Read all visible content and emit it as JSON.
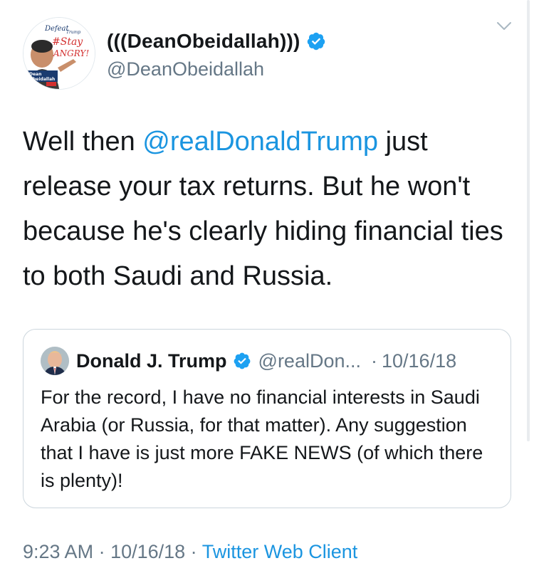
{
  "author": {
    "display_name": "(((DeanObeidallah)))",
    "handle": "@DeanObeidallah",
    "avatar_text_top": "Defeat",
    "avatar_text_trump": "Trump",
    "avatar_text_stay": "#Stay",
    "avatar_text_angry": "ANGRY!",
    "avatar_text_name1": "Dean",
    "avatar_text_name2": "Obeidallah"
  },
  "tweet": {
    "text_before_mention": "Well then ",
    "mention": "@realDonaldTrump",
    "text_after_mention": " just release your tax returns. But he won't because he's clearly hiding financial ties to both Saudi and Russia."
  },
  "quoted_tweet": {
    "display_name": "Donald J. Trump",
    "handle": "@realDon...",
    "separator": "·",
    "date": "10/16/18",
    "text": "For the record, I have no financial interests in Saudi Arabia (or Russia, for that matter). Any suggestion that I have is just more FAKE NEWS (of which there is plenty)!"
  },
  "footer": {
    "time": "9:23 AM",
    "separator1": " · ",
    "date": "10/16/18",
    "separator2": " · ",
    "source": "Twitter Web Client"
  },
  "colors": {
    "link": "#1b95e0",
    "secondary_text": "#657786",
    "primary_text": "#14171a",
    "verified": "#1da1f2",
    "border": "#ccd6dd"
  },
  "icons": {
    "verified": "verified-badge-icon",
    "menu": "chevron-down-icon"
  }
}
